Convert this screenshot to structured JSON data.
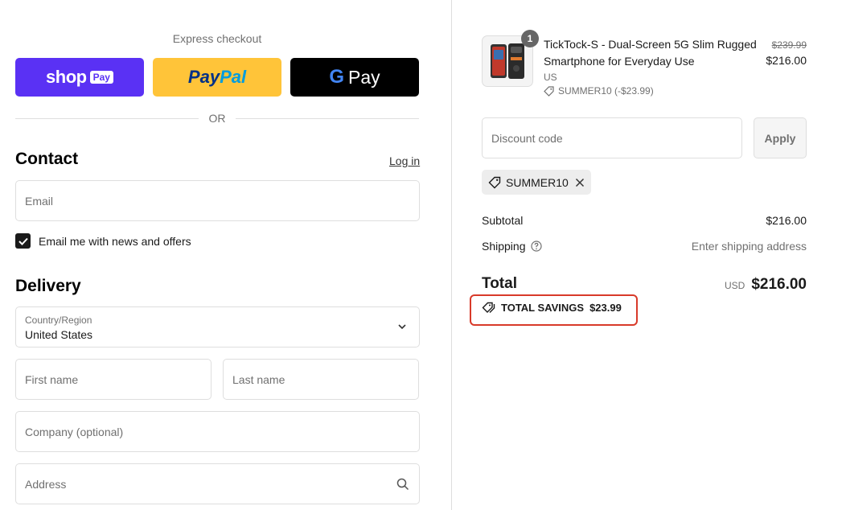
{
  "express": {
    "label": "Express checkout",
    "shop_word": "shop",
    "shop_badge": "Pay",
    "paypal_p1": "Pay",
    "paypal_p2": "Pal",
    "gpay_g": "G",
    "gpay_word": "Pay",
    "or_text": "OR"
  },
  "contact": {
    "title": "Contact",
    "login_label": "Log in",
    "email_placeholder": "Email",
    "newsletter_label": "Email me with news and offers",
    "newsletter_checked": true
  },
  "delivery": {
    "title": "Delivery",
    "country_label": "Country/Region",
    "country_value": "United States",
    "first_name_placeholder": "First name",
    "last_name_placeholder": "Last name",
    "company_placeholder": "Company (optional)",
    "address_placeholder": "Address"
  },
  "order": {
    "item": {
      "quantity": "1",
      "title": "TickTock-S - Dual-Screen 5G Slim Rugged Smartphone for Everyday Use",
      "variant": "US",
      "discount": "SUMMER10 (-$23.99)",
      "price_original": "$239.99",
      "price_final": "$216.00"
    },
    "discount_placeholder": "Discount code",
    "apply_label": "Apply",
    "applied_code": "SUMMER10",
    "subtotal_label": "Subtotal",
    "subtotal_value": "$216.00",
    "shipping_label": "Shipping",
    "shipping_value": "Enter shipping address",
    "total_label": "Total",
    "total_currency": "USD",
    "total_value": "$216.00",
    "savings_label": "TOTAL SAVINGS",
    "savings_value": "$23.99"
  },
  "colors": {
    "shop_pay": "#5a31f4",
    "paypal": "#ffc439",
    "gpay": "#000000",
    "highlight": "#d83a2a"
  },
  "icons": [
    "check-icon",
    "chevron-down-icon",
    "search-icon",
    "tag-icon",
    "close-icon",
    "help-icon",
    "google-g-icon"
  ]
}
